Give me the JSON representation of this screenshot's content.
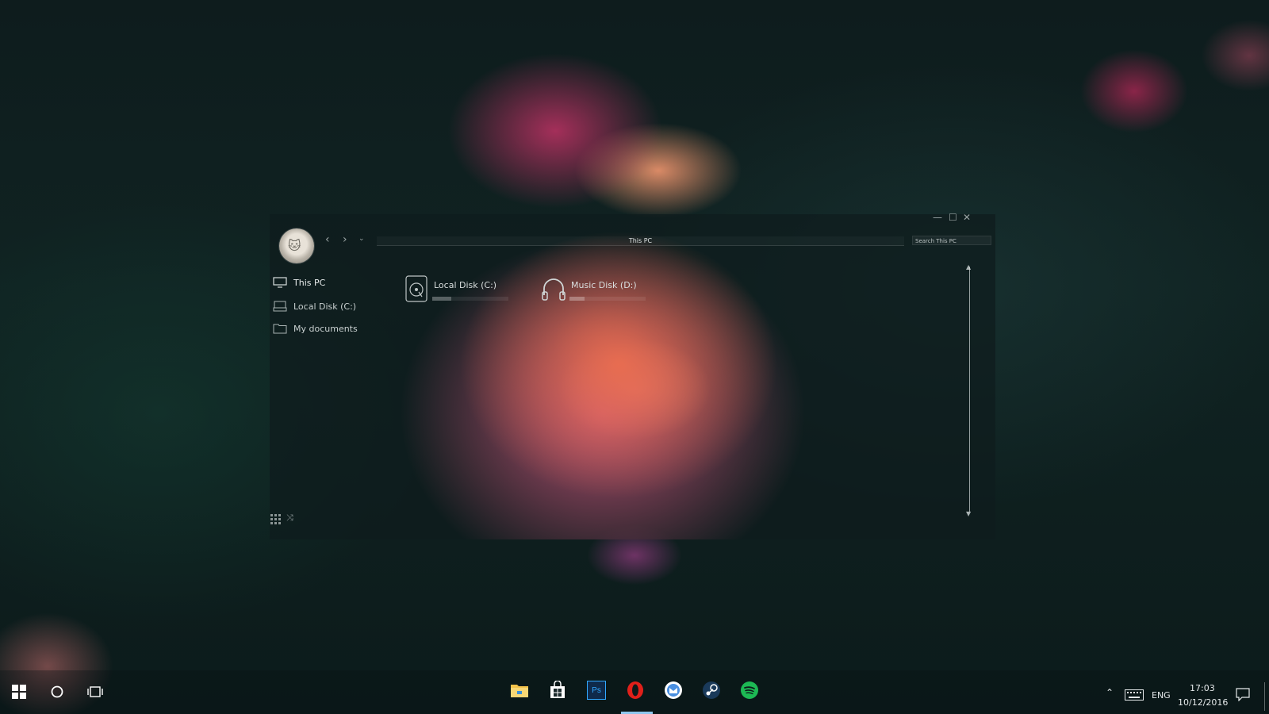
{
  "explorer": {
    "address": "This PC",
    "search_placeholder": "Search This PC",
    "sidebar": [
      {
        "label": "This PC"
      },
      {
        "label": "Local Disk (C:)"
      },
      {
        "label": "My documents"
      }
    ],
    "drives": [
      {
        "label": "Local Disk (C:)",
        "used": 0.25
      },
      {
        "label": "Music Disk (D:)",
        "used": 0.2
      }
    ]
  },
  "taskbar": {
    "apps": [
      "file-explorer-icon",
      "store-icon",
      "photoshop-icon",
      "opera-icon",
      "gmail-icon",
      "steam-icon",
      "spotify-icon"
    ],
    "photoshop_label": "Ps",
    "lang": "ENG",
    "time": "17:03",
    "date": "10/12/2016"
  },
  "colors": {
    "accent": "#8ec7ee",
    "spotify": "#1db954",
    "opera": "#e0201a",
    "photoshop": "#0f2a4a"
  }
}
